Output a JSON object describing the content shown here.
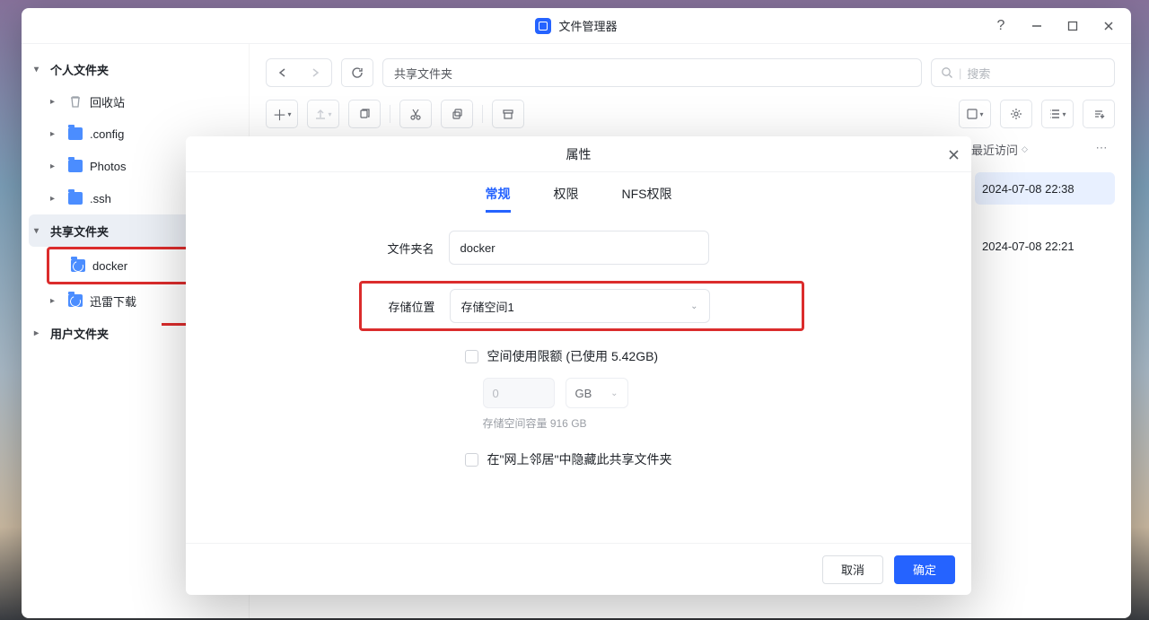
{
  "window": {
    "title": "文件管理器"
  },
  "sidebar": {
    "personal_label": "个人文件夹",
    "items": [
      "回收站",
      ".config",
      "Photos",
      ".ssh"
    ],
    "shared_label": "共享文件夹",
    "shared_items": [
      "docker",
      "迅雷下载"
    ],
    "user_label": "用户文件夹"
  },
  "topbar": {
    "path": "共享文件夹",
    "search_placeholder": "搜索"
  },
  "columns": {
    "recent": "最近访问"
  },
  "rows": {
    "t0": "2024-07-08 22:38",
    "t1": "2024-07-08 22:21"
  },
  "dialog": {
    "title": "属性",
    "tab_general": "常规",
    "tab_perm": "权限",
    "tab_nfs": "NFS权限",
    "label_name": "文件夹名",
    "name_value": "docker",
    "label_location": "存储位置",
    "location_value": "存储空间1",
    "quota_label": "空间使用限额 (已使用 5.42GB)",
    "quota_value_placeholder": "0",
    "quota_unit": "GB",
    "capacity": "存储空间容量 916 GB",
    "hide_label": "在\"网上邻居\"中隐藏此共享文件夹",
    "btn_cancel": "取消",
    "btn_ok": "确定"
  }
}
